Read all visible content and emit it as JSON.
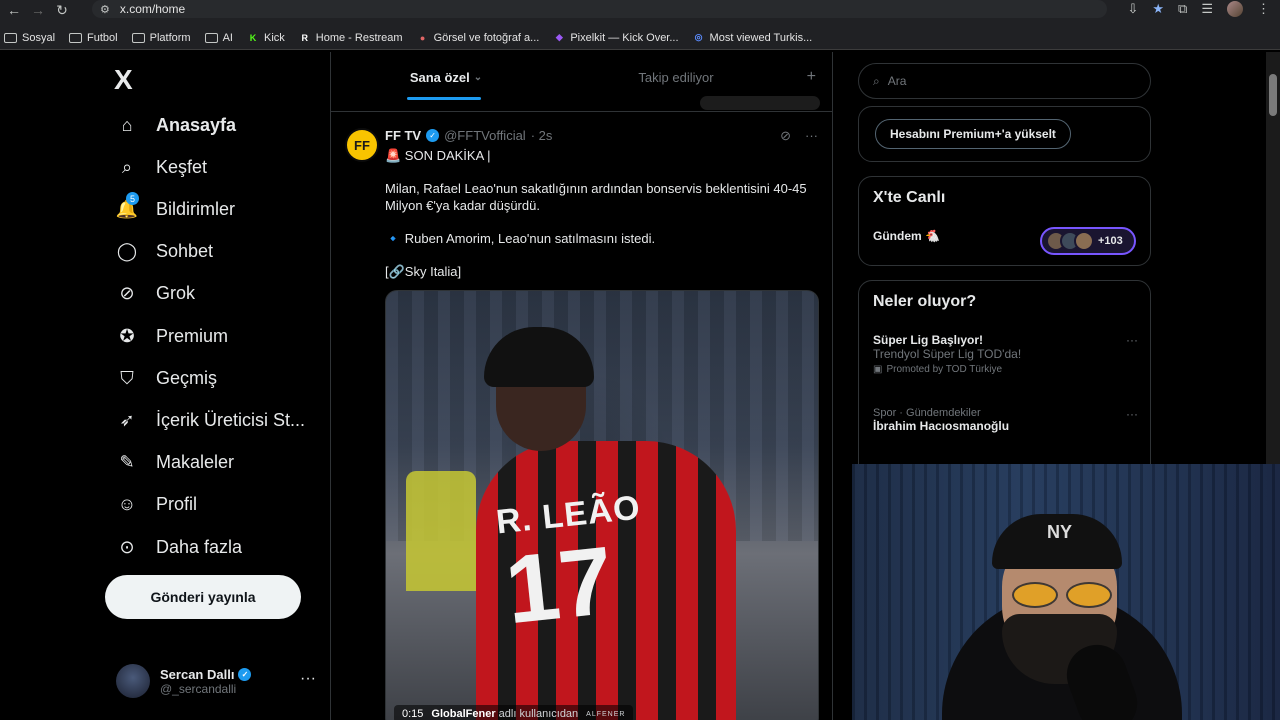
{
  "browser": {
    "url": "x.com/home",
    "bookmarks": [
      {
        "label": "Sosyal",
        "type": "folder"
      },
      {
        "label": "Futbol",
        "type": "folder"
      },
      {
        "label": "Platform",
        "type": "folder"
      },
      {
        "label": "AI",
        "type": "folder"
      },
      {
        "label": "Kick",
        "type": "site",
        "glyph": "K",
        "color": "#53fc18"
      },
      {
        "label": "Home - Restream",
        "type": "site",
        "glyph": "R",
        "color": "#ffffff"
      },
      {
        "label": "Görsel ve fotoğraf a...",
        "type": "site",
        "glyph": "●",
        "color": "#e06666"
      },
      {
        "label": "Pixelkit — Kick Over...",
        "type": "site",
        "glyph": "◆",
        "color": "#9b59f5"
      },
      {
        "label": "Most viewed Turkis...",
        "type": "site",
        "glyph": "◎",
        "color": "#5b8cff"
      }
    ]
  },
  "sidebar": {
    "logo": "X",
    "items": [
      {
        "label": "Anasayfa",
        "icon": "home-icon",
        "active": true
      },
      {
        "label": "Keşfet",
        "icon": "search-icon"
      },
      {
        "label": "Bildirimler",
        "icon": "bell-icon",
        "badge": "5"
      },
      {
        "label": "Sohbet",
        "icon": "chat-icon"
      },
      {
        "label": "Grok",
        "icon": "grok-icon"
      },
      {
        "label": "Premium",
        "icon": "premium-icon"
      },
      {
        "label": "Geçmiş",
        "icon": "bookmark-icon"
      },
      {
        "label": "İçerik Üreticisi St...",
        "icon": "rocket-icon"
      },
      {
        "label": "Makaleler",
        "icon": "article-icon"
      },
      {
        "label": "Profil",
        "icon": "person-icon"
      },
      {
        "label": "Daha fazla",
        "icon": "more-circle-icon"
      }
    ],
    "post_button": "Gönderi yayınla",
    "profile": {
      "name": "Sercan Dallı",
      "handle": "@_sercandalli",
      "more": "···"
    }
  },
  "main": {
    "tabs": [
      {
        "label": "Sana özel",
        "active": true
      },
      {
        "label": "Takip ediliyor"
      }
    ],
    "tweet": {
      "author": "FF TV",
      "handle": "@FFTVofficial",
      "time": "· 2s",
      "avatar_text": "FF",
      "lines": [
        "🚨 SON DAKİKA |",
        "Milan, Rafael Leao'nun sakatlığının ardından bonservis beklentisini 40-45 Milyon €'ya kadar düşürdü.",
        "🔹 Ruben Amorim, Leao'nun satılmasını istedi.",
        "[🔗Sky Italia]"
      ],
      "media": {
        "jersey_name": "R. LEÃO",
        "jersey_number": "17",
        "duration": "0:15",
        "credit_user": "GlobalFener",
        "credit_suffix": "adlı kullanıcıdan",
        "watermark": "ALFENER"
      }
    }
  },
  "right": {
    "search_placeholder": "Ara",
    "premium_button": "Hesabını Premium+'a yükselt",
    "live": {
      "title": "X'te Canlı",
      "label": "Gündem 🐔",
      "count": "+103"
    },
    "trends": {
      "title": "Neler oluyor?",
      "items": [
        {
          "title": "Süper Lig Başlıyor!",
          "subtitle": "Trendyol Süper Lig TOD'da!",
          "promo": "Promoted by TOD Türkiye"
        },
        {
          "meta": "Spor · Gündemdekiler",
          "title": "İbrahim Hacıosmanoğlu"
        }
      ],
      "more": "···"
    }
  },
  "colors": {
    "accent": "#1d9bf0",
    "live_border": "#7856ff"
  }
}
